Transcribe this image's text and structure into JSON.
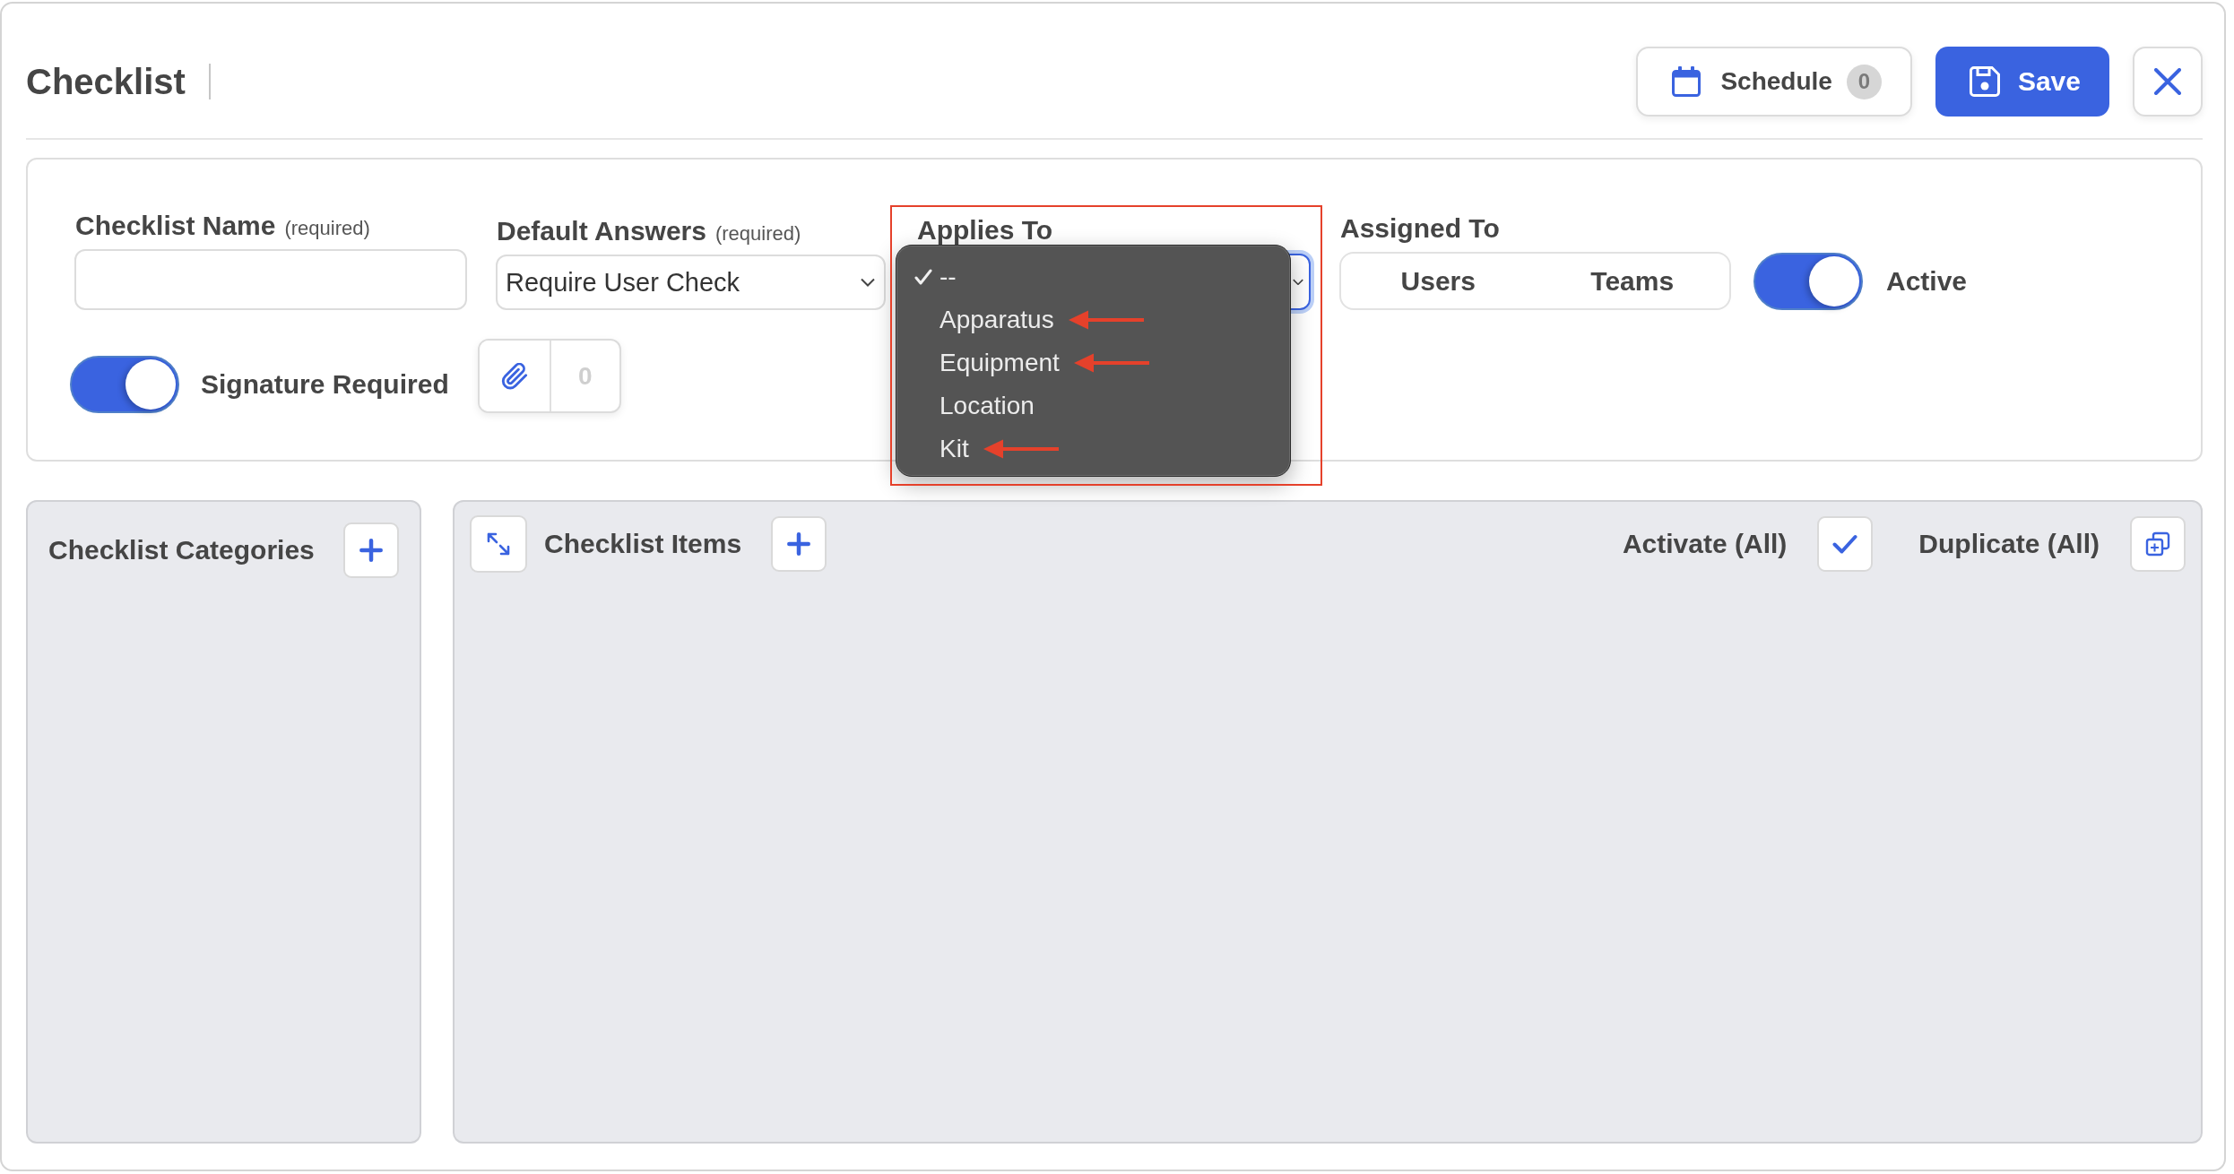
{
  "header": {
    "title": "Checklist",
    "buttons": [
      {
        "kind": "schedule",
        "label": "Schedule",
        "count": "0"
      },
      {
        "kind": "save",
        "label": "Save"
      },
      {
        "kind": "close"
      }
    ]
  },
  "form": {
    "checklist_name": {
      "label": "Checklist Name",
      "note": "(required)"
    },
    "default_answers": {
      "label": "Default Answers",
      "note": "(required)",
      "value": "Require User Check"
    },
    "applies_to": {
      "label": "Applies To",
      "expanded": true,
      "annotated": true,
      "options": [
        {
          "label": "--",
          "selected": true,
          "marked": false
        },
        {
          "label": "Apparatus",
          "selected": false,
          "marked": true
        },
        {
          "label": "Equipment",
          "selected": false,
          "marked": true
        },
        {
          "label": "Location",
          "selected": false,
          "marked": false
        },
        {
          "label": "Kit",
          "selected": false,
          "marked": true
        }
      ]
    },
    "assigned_to": {
      "label": "Assigned To",
      "segments": [
        {
          "label": "Users",
          "selected": false
        },
        {
          "label": "Teams",
          "selected": false
        }
      ]
    },
    "active": {
      "label": "Active",
      "on": true
    },
    "signature_required": {
      "label": "Signature Required",
      "on": true
    },
    "attachments": {
      "count": "0"
    }
  },
  "categories_panel": {
    "title": "Checklist Categories"
  },
  "items_panel": {
    "title": "Checklist Items",
    "actions": [
      {
        "kind": "activate",
        "label": "Activate (All)"
      },
      {
        "kind": "duplicate",
        "label": "Duplicate (All)"
      }
    ]
  }
}
